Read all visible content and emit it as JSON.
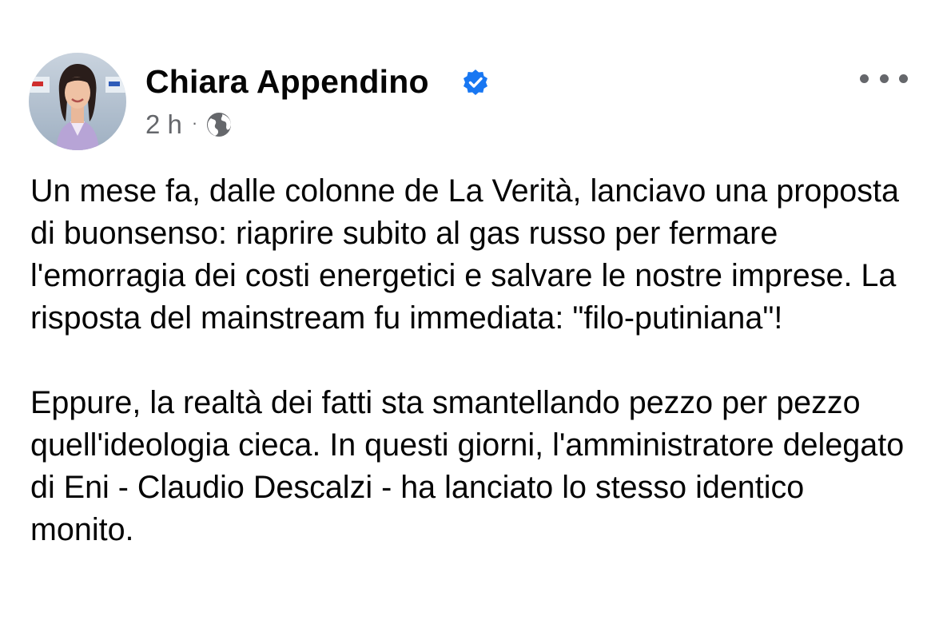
{
  "post": {
    "author": {
      "name": "Chiara Appendino",
      "verified": true,
      "avatar_icon": "profile-photo"
    },
    "timestamp": "2 h",
    "separator": "·",
    "audience_icon": "globe-icon",
    "more_icon": "more-options-icon",
    "paragraphs": [
      "Un mese fa, dalle colonne de La Verità, lanciavo una proposta di buonsenso: riaprire subito al gas russo per fermare l'emorragia dei costi energetici e salvare le nostre imprese. La risposta del mainstream fu immediata: \"filo-putiniana\"!",
      "Eppure, la realtà dei fatti sta smantellando pezzo per pezzo quell'ideologia cieca. In questi giorni, l'amministratore delegato di Eni - Claudio Descalzi - ha lanciato lo stesso identico monito."
    ]
  },
  "colors": {
    "text": "#050505",
    "secondary_text": "#65676b",
    "verified_blue": "#1877f2",
    "background": "#ffffff"
  }
}
